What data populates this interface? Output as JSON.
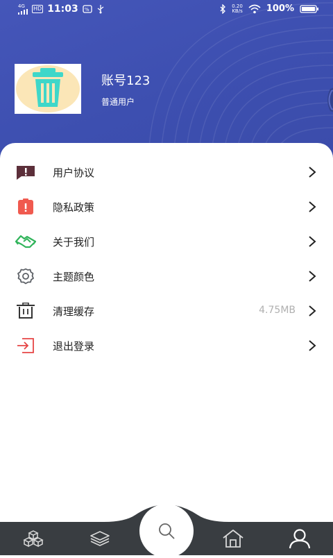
{
  "status_bar": {
    "network": "4G",
    "hd": "HD",
    "time": "11:03",
    "speed_value": "0.20",
    "speed_unit": "KB/s",
    "battery": "100%"
  },
  "profile": {
    "username": "账号123",
    "user_type": "普通用户",
    "avatar_icon": "trash-bin-icon"
  },
  "menu": {
    "items": [
      {
        "label": "用户协议",
        "icon": "alert-message-icon",
        "color": "#5c2f3a",
        "value": ""
      },
      {
        "label": "隐私政策",
        "icon": "privacy-alert-icon",
        "color": "#f05a4f",
        "value": ""
      },
      {
        "label": "关于我们",
        "icon": "handshake-icon",
        "color": "#31b45b",
        "value": ""
      },
      {
        "label": "主题颜色",
        "icon": "gear-icon",
        "color": "#5c6066",
        "value": ""
      },
      {
        "label": "清理缓存",
        "icon": "trash-icon",
        "color": "#333333",
        "value": "4.75MB"
      },
      {
        "label": "退出登录",
        "icon": "logout-icon",
        "color": "#e64545",
        "value": ""
      }
    ]
  },
  "bottom_nav": {
    "items": [
      "blocks-icon",
      "layers-icon",
      "search-icon",
      "home-icon",
      "user-icon"
    ],
    "active": "user-icon"
  },
  "colors": {
    "header": "#4152b4",
    "nav": "#393d41"
  }
}
